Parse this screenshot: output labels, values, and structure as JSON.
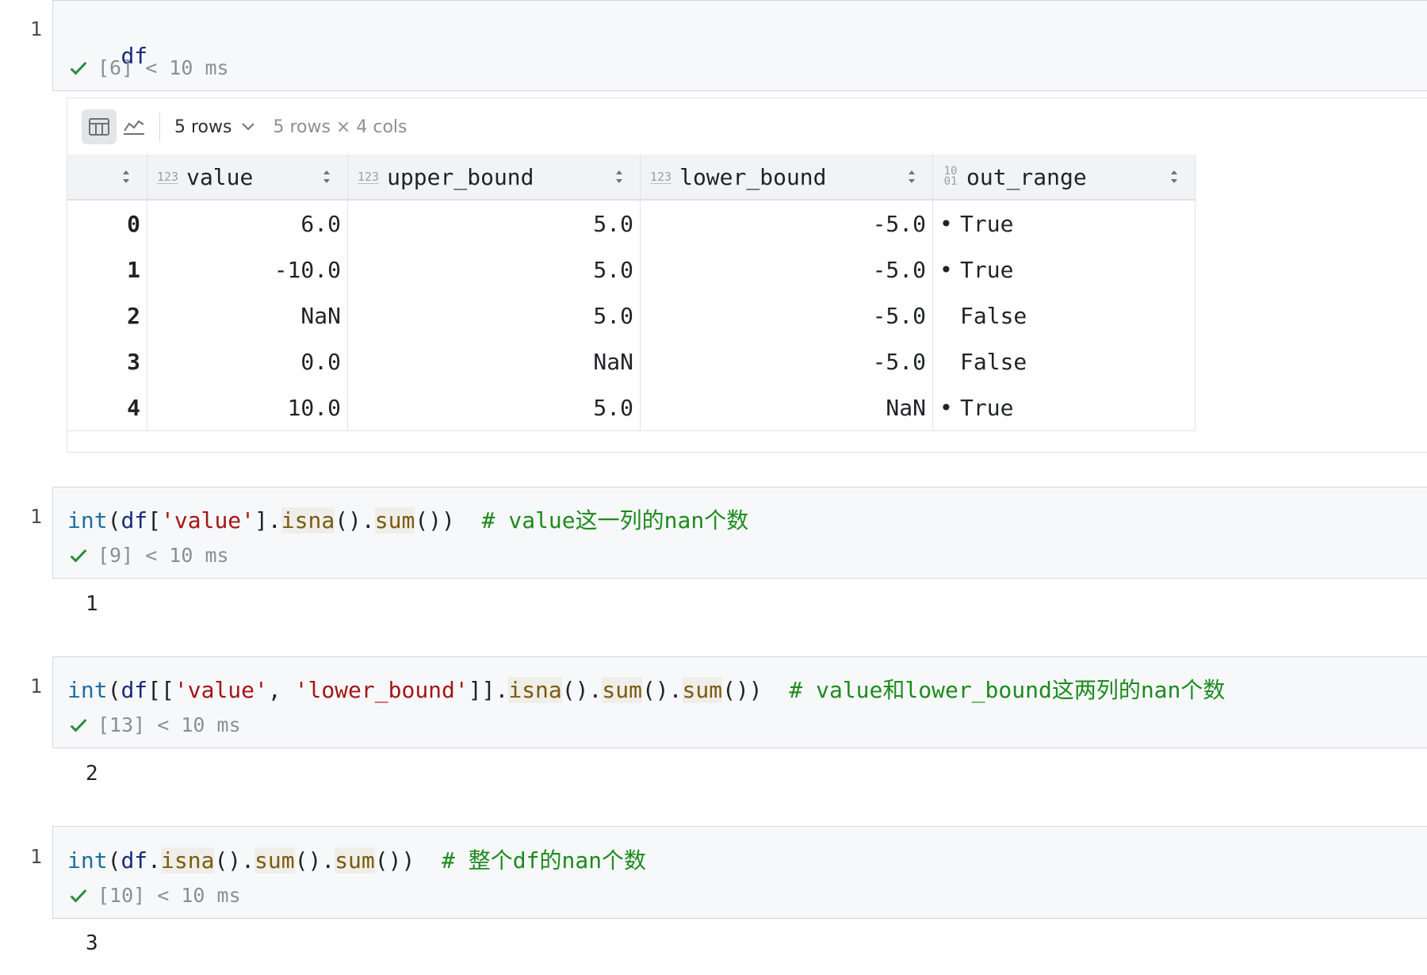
{
  "cells": [
    {
      "number": "1",
      "code": "df",
      "status": "[6] < 10 ms"
    },
    {
      "number": "1",
      "tokens": [
        {
          "t": "int",
          "c": "kw-int"
        },
        {
          "t": "(",
          "c": "punc"
        },
        {
          "t": "df",
          "c": "kw-df"
        },
        {
          "t": "[",
          "c": "punc"
        },
        {
          "t": "'value'",
          "c": "str"
        },
        {
          "t": "].",
          "c": "punc"
        },
        {
          "t": "isna",
          "c": "fn"
        },
        {
          "t": "().",
          "c": "punc"
        },
        {
          "t": "sum",
          "c": "fn"
        },
        {
          "t": "())",
          "c": "punc"
        },
        {
          "t": "  # value这一列的nan个数",
          "c": "cmt"
        }
      ],
      "status": "[9] < 10 ms",
      "output": "1"
    },
    {
      "number": "1",
      "tokens": [
        {
          "t": "int",
          "c": "kw-int"
        },
        {
          "t": "(",
          "c": "punc"
        },
        {
          "t": "df",
          "c": "kw-df"
        },
        {
          "t": "[[",
          "c": "punc"
        },
        {
          "t": "'value'",
          "c": "str"
        },
        {
          "t": ", ",
          "c": "punc"
        },
        {
          "t": "'lower_bound'",
          "c": "str"
        },
        {
          "t": "]].",
          "c": "punc"
        },
        {
          "t": "isna",
          "c": "fn"
        },
        {
          "t": "().",
          "c": "punc"
        },
        {
          "t": "sum",
          "c": "fn"
        },
        {
          "t": "().",
          "c": "punc"
        },
        {
          "t": "sum",
          "c": "fn"
        },
        {
          "t": "())",
          "c": "punc"
        },
        {
          "t": "  # value和lower_bound这两列的nan个数",
          "c": "cmt"
        }
      ],
      "status": "[13] < 10 ms",
      "output": "2"
    },
    {
      "number": "1",
      "tokens": [
        {
          "t": "int",
          "c": "kw-int"
        },
        {
          "t": "(",
          "c": "punc"
        },
        {
          "t": "df",
          "c": "kw-df"
        },
        {
          "t": ".",
          "c": "punc"
        },
        {
          "t": "isna",
          "c": "fn"
        },
        {
          "t": "().",
          "c": "punc"
        },
        {
          "t": "sum",
          "c": "fn"
        },
        {
          "t": "().",
          "c": "punc"
        },
        {
          "t": "sum",
          "c": "fn"
        },
        {
          "t": "())",
          "c": "punc"
        },
        {
          "t": "  # 整个df的nan个数",
          "c": "cmt"
        }
      ],
      "status": "[10] < 10 ms",
      "output": "3"
    }
  ],
  "table": {
    "rows_select": "5 rows",
    "rows_info": "5 rows × 4 cols",
    "columns": [
      {
        "name": "",
        "type": ""
      },
      {
        "name": "value",
        "type": "123"
      },
      {
        "name": "upper_bound",
        "type": "123"
      },
      {
        "name": "lower_bound",
        "type": "123"
      },
      {
        "name": "out_range",
        "type": "bool"
      }
    ],
    "rows": [
      {
        "idx": "0",
        "value": "6.0",
        "upper": "5.0",
        "lower": "-5.0",
        "out": "True",
        "dot": "•"
      },
      {
        "idx": "1",
        "value": "-10.0",
        "upper": "5.0",
        "lower": "-5.0",
        "out": "True",
        "dot": "•"
      },
      {
        "idx": "2",
        "value": "NaN",
        "upper": "5.0",
        "lower": "-5.0",
        "out": "False",
        "dot": ""
      },
      {
        "idx": "3",
        "value": "0.0",
        "upper": "NaN",
        "lower": "-5.0",
        "out": "False",
        "dot": ""
      },
      {
        "idx": "4",
        "value": "10.0",
        "upper": "5.0",
        "lower": "NaN",
        "out": "True",
        "dot": "•"
      }
    ]
  },
  "colors": {
    "check": "#2e8b3e",
    "comment": "#1d8a1d",
    "string": "#a31515"
  }
}
